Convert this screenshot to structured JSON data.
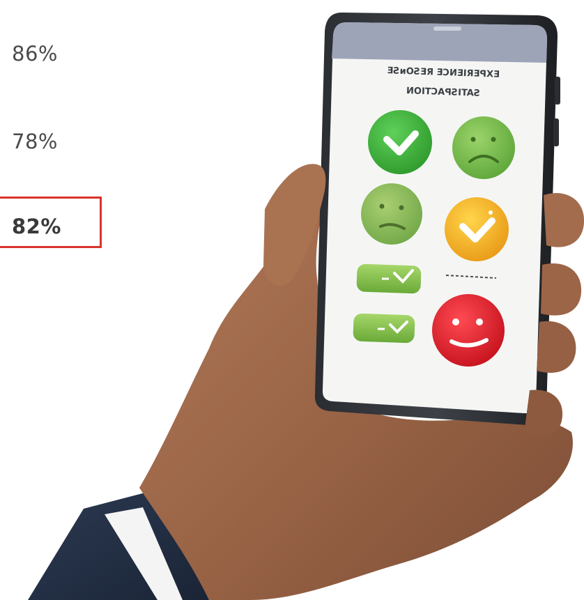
{
  "stats": [
    {
      "label": "86%",
      "highlighted": false
    },
    {
      "label": "78%",
      "highlighted": false
    },
    {
      "label": "82%",
      "highlighted": true
    }
  ],
  "phone_screen": {
    "heading_lines": [
      "ƎƧᴎOƧƎЯ ƎƆИƎIЯƎꟼXƎ",
      "ИOITƆAꟼƧITAƧ"
    ],
    "mirrored_heading": true,
    "options": [
      {
        "icon": "checkmark-face",
        "color": "#3fae3a"
      },
      {
        "icon": "sad-face",
        "color": "#77bd4a"
      },
      {
        "icon": "neutral-face",
        "color": "#8cbc52"
      },
      {
        "icon": "checkmark-face",
        "color": "#f2b62a"
      },
      {
        "icon": "smiley-face",
        "color": "#e8202f"
      }
    ]
  },
  "colors": {
    "highlight_border": "#d8342b",
    "stat_text": "#4a4a4a"
  }
}
